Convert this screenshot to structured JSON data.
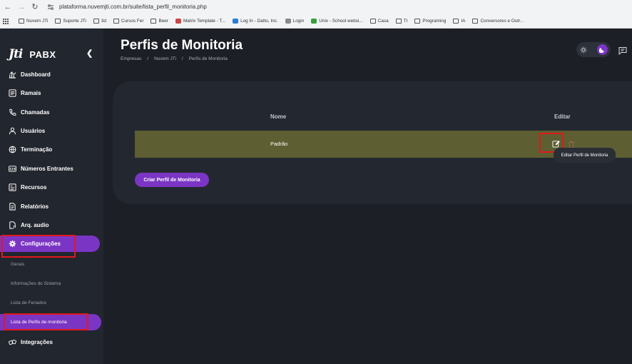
{
  "browser": {
    "url": "plataforma.nuvemjti.com.br/suite/lista_perfil_monitoria.php",
    "bookmarks": [
      {
        "label": "Nuvem JTi",
        "icon": "folder-icon"
      },
      {
        "label": "Suporte JTi",
        "icon": "folder-icon"
      },
      {
        "label": "3d",
        "icon": "folder-icon"
      },
      {
        "label": "Cursos Fer",
        "icon": "folder-icon"
      },
      {
        "label": "Beer",
        "icon": "folder-icon"
      },
      {
        "label": "Matrix Template - T...",
        "icon": "page-icon"
      },
      {
        "label": "Log In - Datto, Inc.",
        "icon": "page-icon"
      },
      {
        "label": "Login",
        "icon": "page-icon"
      },
      {
        "label": "Univ - School websi...",
        "icon": "page-icon"
      },
      {
        "label": "Casa",
        "icon": "folder-icon"
      },
      {
        "label": "TI",
        "icon": "folder-icon"
      },
      {
        "label": "Programing",
        "icon": "folder-icon"
      },
      {
        "label": "IA",
        "icon": "folder-icon"
      },
      {
        "label": "Conversores e Outr...",
        "icon": "folder-icon"
      }
    ]
  },
  "sidebar": {
    "logo_text": "Jti",
    "brand": "PABX",
    "items": [
      {
        "label": "Dashboard",
        "icon": "dashboard-icon"
      },
      {
        "label": "Ramais",
        "icon": "ramais-icon"
      },
      {
        "label": "Chamadas",
        "icon": "phone-icon"
      },
      {
        "label": "Usuários",
        "icon": "user-icon"
      },
      {
        "label": "Terminação",
        "icon": "globe-icon"
      },
      {
        "label": "Números Entrantes",
        "icon": "numbers-icon"
      },
      {
        "label": "Recursos",
        "icon": "resources-icon"
      },
      {
        "label": "Relatórios",
        "icon": "report-icon"
      },
      {
        "label": "Arq. audio",
        "icon": "audio-file-icon"
      },
      {
        "label": "Configurações",
        "icon": "gear-icon"
      },
      {
        "label": "Integrações",
        "icon": "integration-icon"
      }
    ],
    "sub_items": [
      {
        "label": "Gerais"
      },
      {
        "label": "Informações do Sistema"
      },
      {
        "label": "Lista de Feriados"
      },
      {
        "label": "Lista de Perfis de monitoria"
      }
    ]
  },
  "header": {
    "title": "Perfis de Monitoria",
    "breadcrumb": [
      "Empresas",
      "Nuvem JTi",
      "Perfis de Monitoria"
    ]
  },
  "table": {
    "columns": [
      "Nome",
      "Editar"
    ],
    "rows": [
      {
        "name": "Padrão"
      }
    ]
  },
  "tooltip": "Editar Perfil de Monitoria",
  "create_button": "Criar Perfil de Monitoria",
  "colors": {
    "accent": "#7b35c4",
    "row_highlight": "#5d5e32",
    "annotation": "#e0191b"
  }
}
